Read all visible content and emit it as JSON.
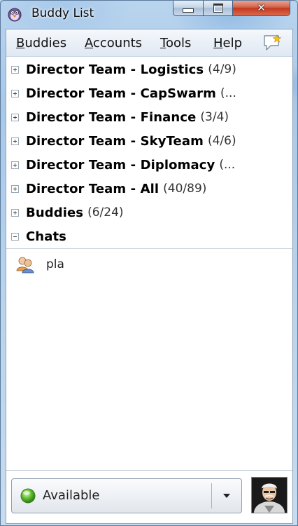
{
  "window": {
    "title": "Buddy List",
    "close_glyph": "✕"
  },
  "menu": {
    "buddies": {
      "accel": "B",
      "rest": "uddies"
    },
    "accounts": {
      "accel": "A",
      "rest": "ccounts"
    },
    "tools": {
      "accel": "T",
      "rest": "ools"
    },
    "help": {
      "accel": "H",
      "rest": "elp"
    }
  },
  "groups": [
    {
      "name": "Director Team - Logistics",
      "count": "(4/9)",
      "expanded": false
    },
    {
      "name": "Director Team - CapSwarm",
      "count": "(...",
      "expanded": false
    },
    {
      "name": "Director Team - Finance",
      "count": "(3/4)",
      "expanded": false
    },
    {
      "name": "Director Team - SkyTeam",
      "count": "(4/6)",
      "expanded": false
    },
    {
      "name": "Director Team - Diplomacy",
      "count": "(...",
      "expanded": false
    },
    {
      "name": "Director Team - All",
      "count": "(40/89)",
      "expanded": false
    },
    {
      "name": "Buddies",
      "count": "(6/24)",
      "expanded": false
    },
    {
      "name": "Chats",
      "count": "",
      "expanded": true
    }
  ],
  "chats": [
    {
      "name": "pla"
    }
  ],
  "status": {
    "label": "Available",
    "color": "#5dbb2c"
  },
  "icons": {
    "app": "pidgin-icon",
    "note": "new-message-icon",
    "chat": "chat-group-icon",
    "status": "available-status-icon",
    "avatar": "buddy-avatar"
  }
}
